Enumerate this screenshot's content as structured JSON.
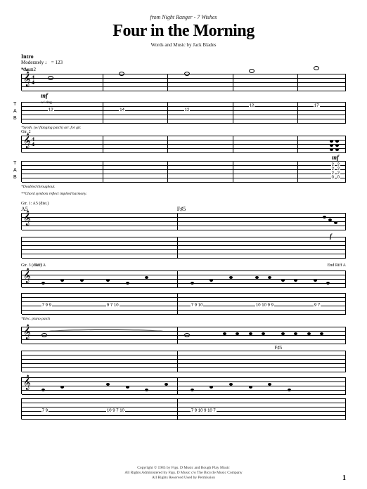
{
  "header": {
    "source": "from Night Ranger - 7 Wishes",
    "title": "Four in the Morning",
    "credits": "Words and Music by Jack Blades"
  },
  "intro": {
    "label": "Intro",
    "tempo": "Moderately ♩ = 123",
    "chord": "*Asus2"
  },
  "gtr1": {
    "label": "*Gtr. 1",
    "dynamic": "mf",
    "technique": "w/ ring",
    "footnote": "*Synth. (w/ flanging patch) arr. for gtr."
  },
  "gtr2": {
    "label": "Gtr. 2",
    "dynamic": "mf",
    "footnote1": "*Doubled throughout.",
    "footnote2": "**Chord symbols reflect implied harmony."
  },
  "system2": {
    "gtr1chord": "Gtr. 1: A5 (dist.)",
    "chord_a5": "A5",
    "chord_f5": "F♯5",
    "riff_a": "Riff A",
    "end_riff_a": "End Riff A",
    "gtr3": "Gtr. 3 (dist.)",
    "dynamic_f": "f",
    "dist_note": "*Elec. piano patch"
  },
  "system3": {
    "chord_f5": "F♯5"
  },
  "tab_numbers": {
    "intro_line": [
      "12",
      "14",
      "12",
      "12",
      "17"
    ],
    "intro_chord": [
      "2",
      "2",
      "2",
      "0",
      "0"
    ],
    "riff_a": [
      "7 9 9",
      "9 7 10",
      "7 9 10",
      "10 10 9 9",
      "9 7"
    ],
    "riff_b": [
      "7 9",
      "10 9 7 10",
      "7 9 10 9 10 7"
    ]
  },
  "copyright": {
    "line1": "Copyright © 1985 by Figs. D Music and Rough Play Music",
    "line2": "All Rights Administered by Figs. D Music c/o The Bicycle Music Company",
    "line3": "All Rights Reserved   Used by Permission"
  },
  "page_number": "1"
}
